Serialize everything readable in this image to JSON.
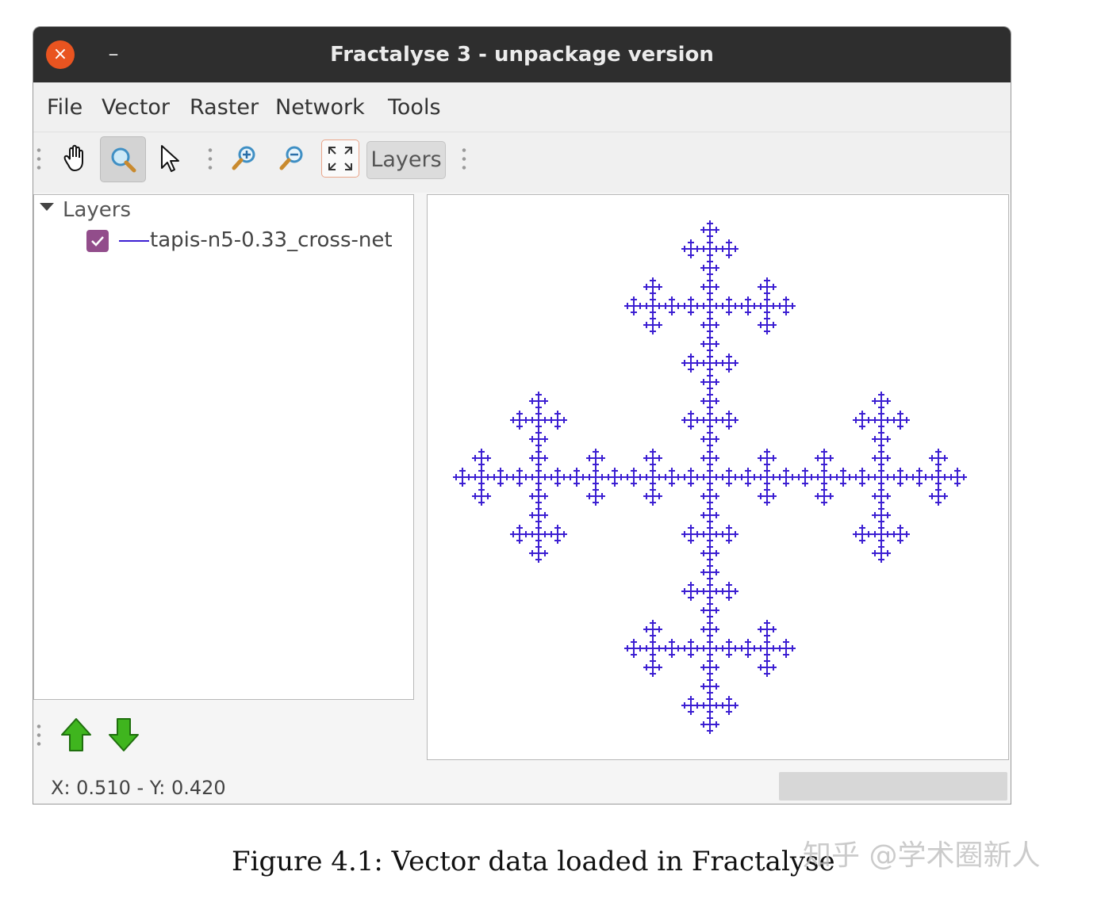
{
  "window": {
    "title": "Fractalyse 3 - unpackage version",
    "close_glyph": "×",
    "minimize_glyph": "–"
  },
  "menu": [
    "File",
    "Vector",
    "Raster",
    "Network",
    "Tools"
  ],
  "toolbar": {
    "buttons": [
      "pan-hand-icon",
      "zoom-select-icon",
      "select-arrow-icon",
      "zoom-in-icon",
      "zoom-out-icon",
      "zoom-extent-icon"
    ],
    "active_button": "zoom-select-icon",
    "layers_label": "Layers"
  },
  "layers_panel": {
    "root_label": "Layers",
    "layers": [
      {
        "name": "tapis-n5-0.33_cross-net",
        "checked": true,
        "color": "#3c1fd2"
      }
    ],
    "buttons": [
      "move-up-icon",
      "move-down-icon"
    ]
  },
  "map": {
    "line_color": "#3c1fd2",
    "fractal": "cross",
    "levels": 4
  },
  "status": {
    "coords": "X: 0.510 - Y: 0.420"
  },
  "caption": "Figure 4.1: Vector data loaded in Fractalyse",
  "watermark": "知乎 @学术圈新人"
}
